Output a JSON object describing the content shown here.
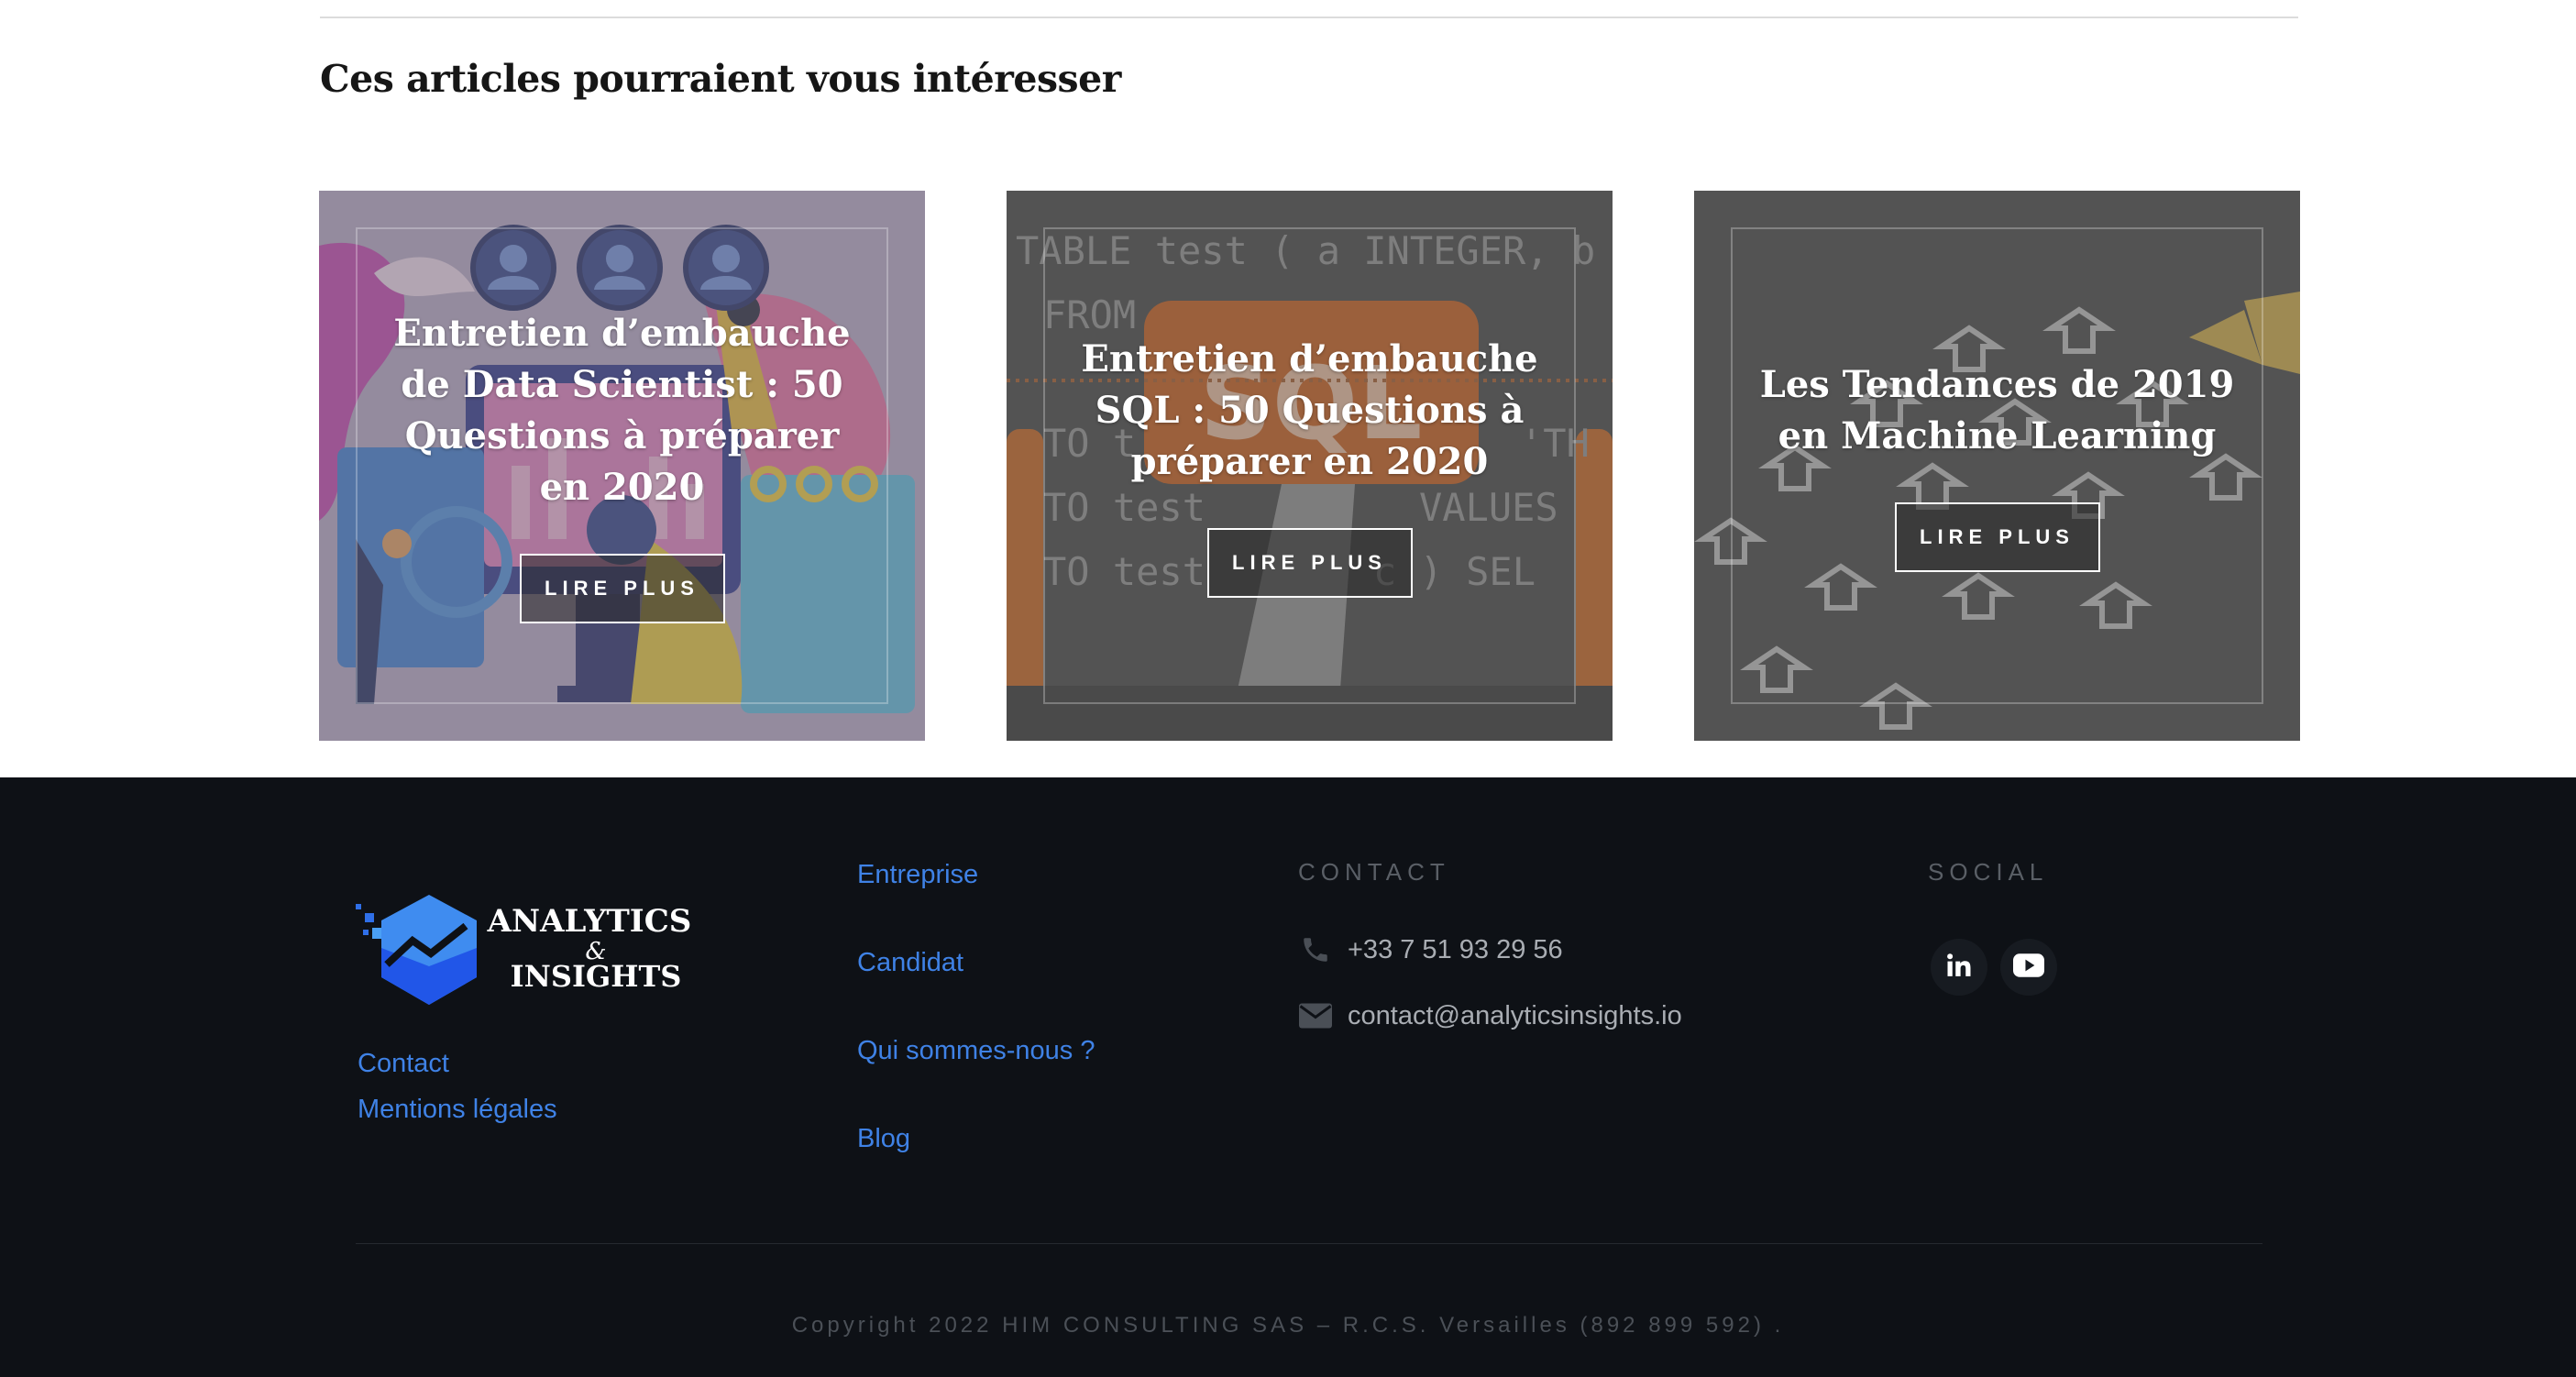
{
  "related": {
    "title": "Ces articles pourraient vous intéresser",
    "cards": [
      {
        "title": "Entretien d’embauche de Data Scientist : 50 Questions à préparer en 2020",
        "button": "LIRE PLUS"
      },
      {
        "title": "Entretien d’embauche SQL : 50 Questions à préparer en 2020",
        "button": "LIRE PLUS"
      },
      {
        "title": "Les Tendances de 2019 en Machine Learning",
        "button": "LIRE PLUS"
      }
    ]
  },
  "sql_image_text": {
    "line1": "TABLE test ( a INTEGER, b T",
    "line2": "FROM",
    "line3": "TO t",
    "line4": "'TH",
    "line5": "TO test",
    "line6": "VALUES",
    "line7": "TO test",
    "line8": "c ) SEL",
    "badge": "SQL"
  },
  "footer": {
    "logo": {
      "line1": "ANALYTICS",
      "line2": "&",
      "line3": "INSIGHTS"
    },
    "left_links": [
      "Contact",
      "Mentions légales"
    ],
    "nav_links": [
      "Entreprise",
      "Candidat",
      "Qui sommes-nous ?",
      "Blog"
    ],
    "contact_heading": "CONTACT",
    "phone": "+33 7 51 93 29 56",
    "email": "contact@analyticsinsights.io",
    "social_heading": "SOCIAL",
    "social": [
      "linkedin-icon",
      "youtube-icon"
    ],
    "copyright": "Copyright 2022 HIM CONSULTING SAS – R.C.S. Versailles (892 899 592) ."
  },
  "colors": {
    "footer_bg": "#0e1116",
    "link_blue": "#3f82e6",
    "muted": "#5a5f66",
    "logo_blue": "#3f8cf0"
  }
}
